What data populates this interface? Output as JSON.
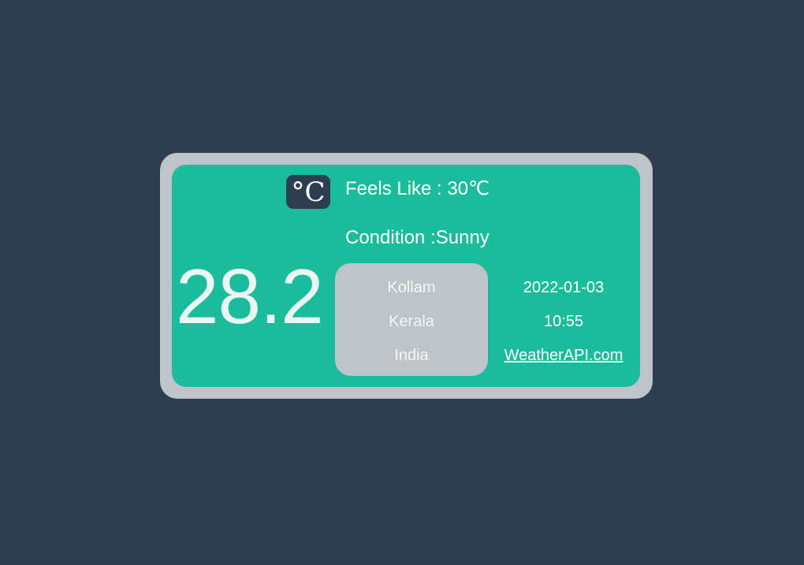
{
  "weather": {
    "unit_symbol": "°C",
    "feels_like_label": "Feels Like :",
    "feels_like_value": "30",
    "feels_like_unit": "℃",
    "condition_label": "Condition :",
    "condition_value": "Sunny",
    "temperature": "28.2"
  },
  "location": {
    "city": "Kollam",
    "region": "Kerala",
    "country": "India"
  },
  "meta": {
    "date": "2022-01-03",
    "time": "10:55",
    "source_link": "WeatherAPI.com"
  },
  "colors": {
    "background": "#2e3e51",
    "frame": "#bfc4c8",
    "card": "#1bbc9b",
    "location_box": "#bfc4c8"
  }
}
